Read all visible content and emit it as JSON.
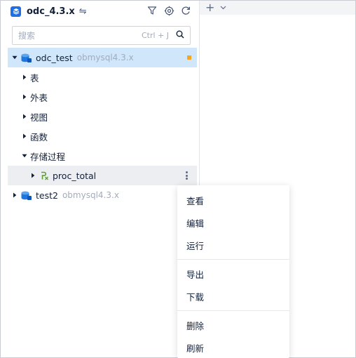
{
  "header": {
    "title": "odc_4.3.x",
    "swap_glyph": "⇋",
    "icon_filter": "filter-icon",
    "icon_locate": "locate-icon",
    "icon_refresh": "refresh-icon"
  },
  "search": {
    "placeholder": "搜索",
    "shortcut": "Ctrl + J"
  },
  "right_toolbar": {
    "add_glyph": "+",
    "chevron_glyph": "⌄"
  },
  "tree": {
    "db1": {
      "name": "odc_test",
      "sub": "obmysql4.3.x",
      "status_color": "#f5a623"
    },
    "groups": [
      {
        "label": "表"
      },
      {
        "label": "外表"
      },
      {
        "label": "视图"
      },
      {
        "label": "函数"
      },
      {
        "label": "存储过程"
      }
    ],
    "proc": {
      "label": "proc_total",
      "icon": "procedure-icon"
    },
    "db2": {
      "name": "test2",
      "sub": "obmysql4.3.x"
    }
  },
  "context_menu": {
    "items": [
      {
        "label": "查看"
      },
      {
        "label": "编辑"
      },
      {
        "label": "运行"
      },
      {
        "label": "导出"
      },
      {
        "label": "下载"
      },
      {
        "label": "删除"
      },
      {
        "label": "刷新"
      }
    ]
  },
  "colors": {
    "accent": "#1f6fe5",
    "selected_bg": "#cfe6fb",
    "proc_icon": "#5aa02c"
  }
}
